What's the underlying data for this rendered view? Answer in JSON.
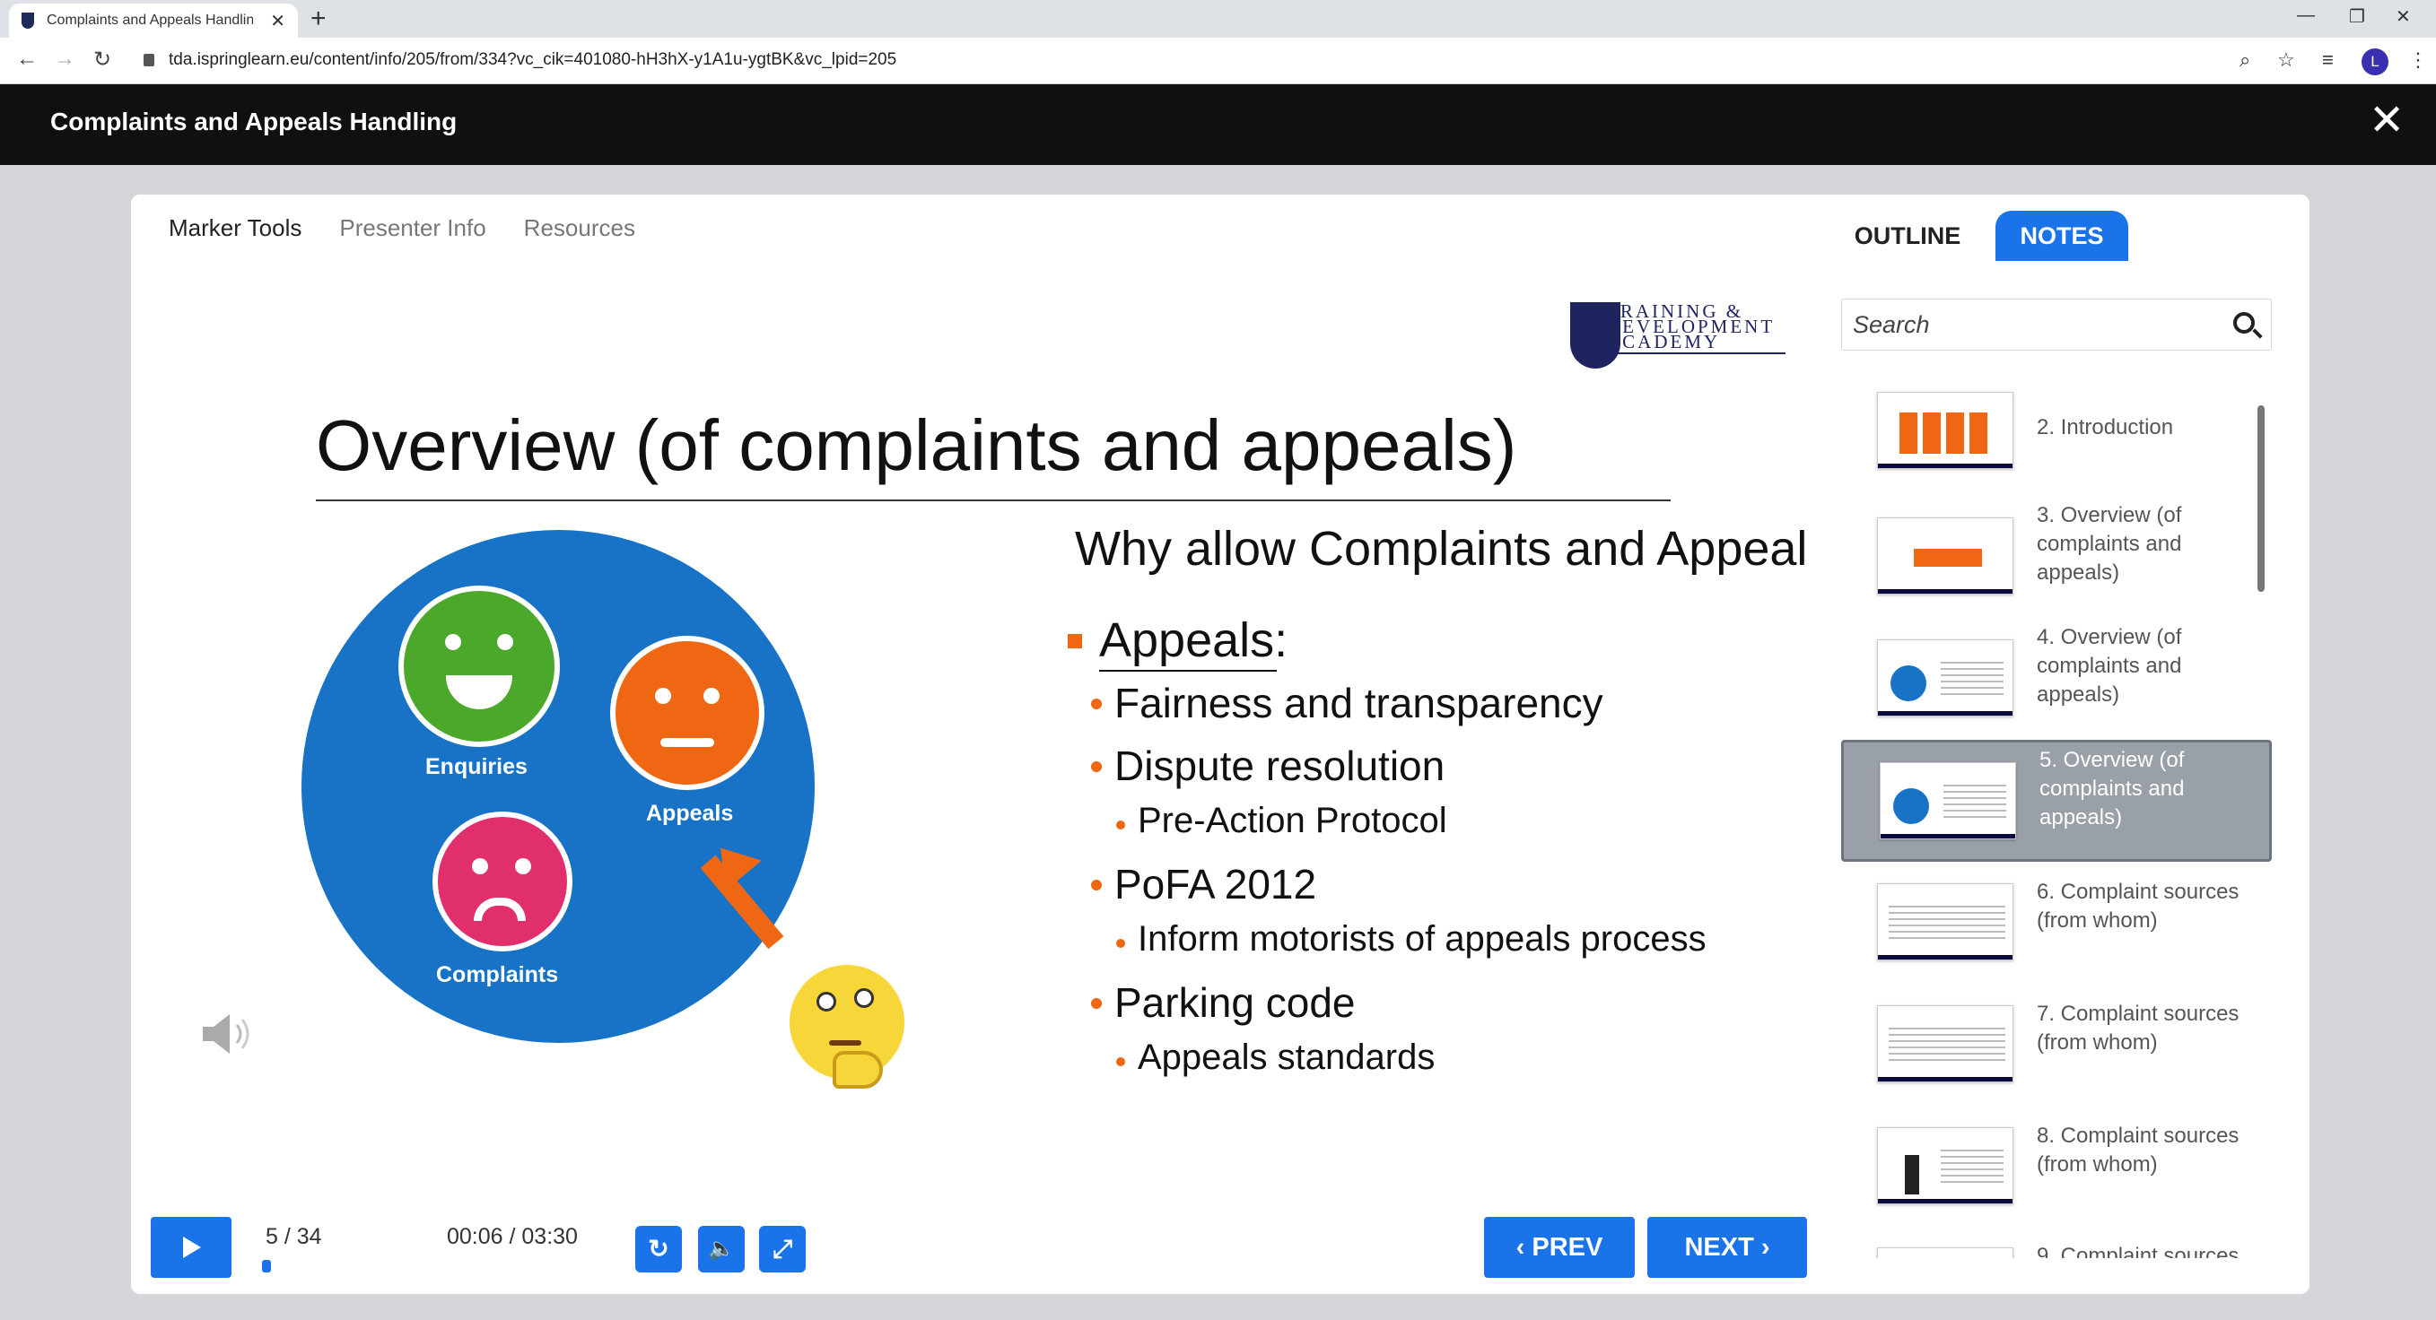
{
  "browser": {
    "tab_title": "Complaints and Appeals Handlin",
    "url": "tda.ispringlearn.eu/content/info/205/from/334?vc_cik=401080-hH3hX-y1A1u-ygtBK&vc_lpid=205",
    "profile_initial": "L"
  },
  "player": {
    "course_title": "Complaints and Appeals Handling"
  },
  "top_menu": [
    "Marker Tools",
    "Presenter Info",
    "Resources"
  ],
  "slide": {
    "logo_text_line1": "TRAINING &",
    "logo_text_line2": "DEVELOPMENT",
    "logo_text_line3": "ACADEMY",
    "title": "Overview (of complaints and appeals)",
    "subheading": "Why allow Complaints and Appeals?",
    "face_labels": {
      "enquiries": "Enquiries",
      "appeals": "Appeals",
      "complaints": "Complaints"
    },
    "bullets": {
      "appeals": "Appeals:",
      "fairness": "Fairness and transparency",
      "dispute": "Dispute resolution",
      "pre_action": "Pre-Action Protocol",
      "pofa": "PoFA 2012",
      "inform": "Inform motorists of appeals process",
      "parking": "Parking code",
      "standards": "Appeals standards"
    }
  },
  "controls": {
    "slide_count": "5 / 34",
    "time": "00:06 / 03:30",
    "prev_label": "PREV",
    "next_label": "NEXT",
    "accent": "#1a73e8"
  },
  "sidebar": {
    "outline_tab": "OUTLINE",
    "notes_tab": "NOTES",
    "search_placeholder": "Search",
    "items": [
      {
        "label": "2. Introduction",
        "thumb": "grid"
      },
      {
        "label": "3. Overview (of complaints and appeals)",
        "thumb": "arrow"
      },
      {
        "label": "4. Overview (of complaints and appeals)",
        "thumb": "circle"
      },
      {
        "label": "5. Overview (of complaints and appeals)",
        "thumb": "circle",
        "selected": true
      },
      {
        "label": "6. Complaint sources (from whom)",
        "thumb": "lines"
      },
      {
        "label": "7. Complaint sources (from whom)",
        "thumb": "lines"
      },
      {
        "label": "8. Complaint sources (from whom)",
        "thumb": "figure"
      },
      {
        "label": "9. Complaint sources",
        "thumb": "lines"
      }
    ]
  }
}
